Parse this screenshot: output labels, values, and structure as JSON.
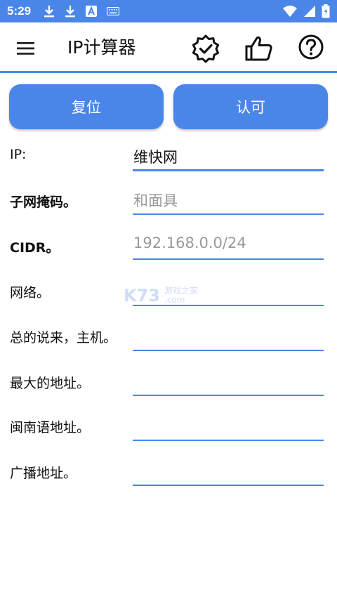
{
  "status_bar": {
    "time": "5:29",
    "icons_left": [
      "download-icon",
      "download-icon",
      "text-a-icon",
      "keyboard-icon"
    ],
    "icons_right": [
      "wifi-icon",
      "signal-icon",
      "battery-icon"
    ],
    "color": "#4a86e8"
  },
  "app_bar": {
    "title": "IP计算器",
    "actions": [
      "verified-badge-icon",
      "thumbs-up-icon",
      "help-circle-icon"
    ]
  },
  "buttons": {
    "reset": "复位",
    "approve": "认可"
  },
  "fields": [
    {
      "label": "IP:",
      "value": "维快网",
      "placeholder": ""
    },
    {
      "label": "子网掩码。",
      "value": "",
      "placeholder": "和面具"
    },
    {
      "label": "CIDR。",
      "value": "",
      "placeholder": "192.168.0.0/24"
    },
    {
      "label": "网络。",
      "value": "",
      "placeholder": ""
    },
    {
      "label": "总的说来，主机。",
      "value": "",
      "placeholder": ""
    },
    {
      "label": "最大的地址。",
      "value": "",
      "placeholder": ""
    },
    {
      "label": "闽南语地址。",
      "value": "",
      "placeholder": ""
    },
    {
      "label": "广播地址。",
      "value": "",
      "placeholder": ""
    }
  ],
  "watermark": {
    "logo": "K73",
    "text": "游戏之家",
    "domain": ".com"
  },
  "colors": {
    "accent": "#4a86e8",
    "placeholder": "#999999"
  }
}
